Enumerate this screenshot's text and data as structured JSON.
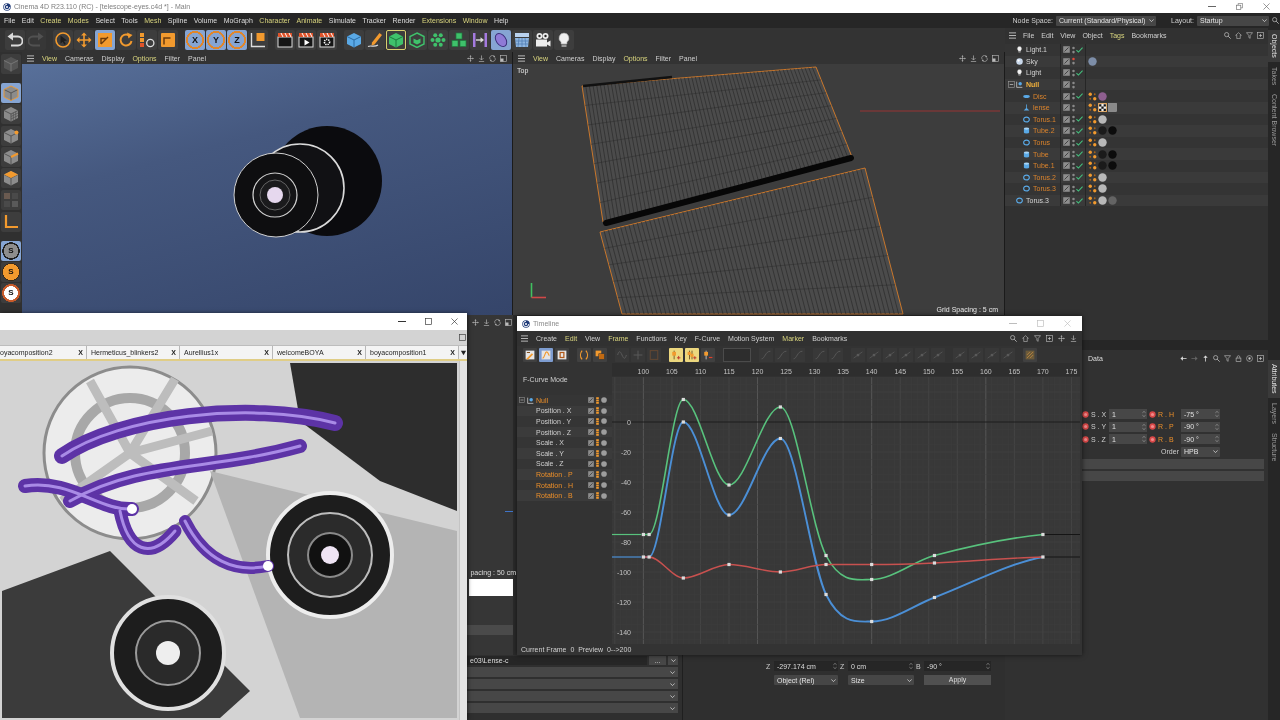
{
  "window": {
    "title": "Cinema 4D R23.110 (RC) - [telescope-eyes.c4d *] - Main"
  },
  "menu": [
    {
      "label": "File",
      "highlighted": false
    },
    {
      "label": "Edit",
      "highlighted": false
    },
    {
      "label": "Create",
      "highlighted": true
    },
    {
      "label": "Modes",
      "highlighted": true
    },
    {
      "label": "Select",
      "highlighted": false
    },
    {
      "label": "Tools",
      "highlighted": false
    },
    {
      "label": "Mesh",
      "highlighted": true
    },
    {
      "label": "Spline",
      "highlighted": false
    },
    {
      "label": "Volume",
      "highlighted": false
    },
    {
      "label": "MoGraph",
      "highlighted": false
    },
    {
      "label": "Character",
      "highlighted": true
    },
    {
      "label": "Animate",
      "highlighted": true
    },
    {
      "label": "Simulate",
      "highlighted": false
    },
    {
      "label": "Tracker",
      "highlighted": false
    },
    {
      "label": "Render",
      "highlighted": false
    },
    {
      "label": "Extensions",
      "highlighted": true
    },
    {
      "label": "Window",
      "highlighted": true
    },
    {
      "label": "Help",
      "highlighted": false
    }
  ],
  "node_space": {
    "label": "Node Space:",
    "value": "Current (Standard/Physical)"
  },
  "layout": {
    "label": "Layout:",
    "value": "Startup"
  },
  "toolbar": [
    {
      "buttons": [
        {
          "kind": "undo",
          "active": false,
          "framed": false,
          "disabled": false
        },
        {
          "kind": "redo",
          "active": false,
          "framed": false,
          "disabled": true
        }
      ]
    },
    {
      "buttons": [
        {
          "kind": "select",
          "active": false,
          "framed": false,
          "disabled": false
        },
        {
          "kind": "move",
          "active": false,
          "framed": false,
          "disabled": false
        },
        {
          "kind": "scale",
          "active": true,
          "framed": false,
          "disabled": false
        },
        {
          "kind": "rotate",
          "active": false,
          "framed": false,
          "disabled": false
        },
        {
          "kind": "psr",
          "active": false,
          "framed": false,
          "disabled": false
        },
        {
          "kind": "recent",
          "active": false,
          "framed": false,
          "disabled": false
        }
      ]
    },
    {
      "buttons": [
        {
          "kind": "axis",
          "label": "X",
          "active": true,
          "framed": false,
          "disabled": false
        },
        {
          "kind": "axis",
          "label": "Y",
          "active": true,
          "framed": false,
          "disabled": false
        },
        {
          "kind": "axis",
          "label": "Z",
          "active": true,
          "framed": false,
          "disabled": false
        },
        {
          "kind": "coord",
          "active": false,
          "framed": false,
          "disabled": false
        }
      ]
    },
    {
      "buttons": [
        {
          "kind": "render-view",
          "active": false,
          "framed": false,
          "disabled": false
        },
        {
          "kind": "render",
          "active": false,
          "framed": false,
          "disabled": false
        },
        {
          "kind": "render-settings",
          "active": false,
          "framed": false,
          "disabled": false
        }
      ]
    },
    {
      "buttons": [
        {
          "kind": "cube",
          "active": false,
          "framed": false,
          "disabled": false
        },
        {
          "kind": "pen",
          "active": false,
          "framed": false,
          "disabled": false
        },
        {
          "kind": "generator",
          "active": false,
          "framed": true,
          "disabled": false
        },
        {
          "kind": "subdivision",
          "active": false,
          "framed": false,
          "disabled": false
        },
        {
          "kind": "cloner",
          "active": false,
          "framed": false,
          "disabled": false
        },
        {
          "kind": "mograph",
          "active": false,
          "framed": false,
          "disabled": false
        },
        {
          "kind": "deformer",
          "active": false,
          "framed": false,
          "disabled": false
        },
        {
          "kind": "field",
          "active": true,
          "framed": false,
          "disabled": false
        },
        {
          "kind": "floor",
          "active": false,
          "framed": false,
          "disabled": false
        },
        {
          "kind": "camera",
          "active": false,
          "framed": false,
          "disabled": false
        },
        {
          "kind": "light",
          "active": false,
          "framed": false,
          "disabled": false
        }
      ]
    }
  ],
  "tool_palette": [
    {
      "buttons": [
        {
          "kind": "editable",
          "active": false
        }
      ]
    },
    {
      "buttons": [
        {
          "kind": "model",
          "active": true
        },
        {
          "kind": "texture",
          "active": false
        }
      ]
    },
    {
      "buttons": [
        {
          "kind": "points",
          "active": false
        },
        {
          "kind": "edges",
          "active": false
        },
        {
          "kind": "polygons",
          "active": false
        }
      ]
    },
    {
      "buttons": [
        {
          "kind": "uv",
          "active": false
        }
      ]
    },
    {
      "buttons": [
        {
          "kind": "axis-mode",
          "active": false
        }
      ]
    },
    {
      "buttons": [
        {
          "kind": "snap-gray",
          "label": "S",
          "active": true
        },
        {
          "kind": "snap-orange",
          "label": "S",
          "active": false
        },
        {
          "kind": "snap-white",
          "label": "S",
          "active": false
        }
      ]
    }
  ],
  "viewports": [
    {
      "kind": "render",
      "menu": [
        {
          "label": "View",
          "highlighted": true
        },
        {
          "label": "Cameras",
          "highlighted": false
        },
        {
          "label": "Display",
          "highlighted": false
        },
        {
          "label": "Options",
          "highlighted": true
        },
        {
          "label": "Filter",
          "highlighted": false
        },
        {
          "label": "Panel",
          "highlighted": false
        }
      ]
    },
    {
      "kind": "wireframe",
      "menu": [
        {
          "label": "View",
          "highlighted": true
        },
        {
          "label": "Cameras",
          "highlighted": false
        },
        {
          "label": "Display",
          "highlighted": false
        },
        {
          "label": "Options",
          "highlighted": true
        },
        {
          "label": "Filter",
          "highlighted": false
        },
        {
          "label": "Panel",
          "highlighted": false
        }
      ],
      "view_label": "Top",
      "grid_spacing": "Grid Spacing : 5 cm"
    }
  ],
  "lower_viewport": {
    "grid_spacing": "pacing : 50 cm"
  },
  "object_manager": {
    "menu": [
      {
        "label": "File",
        "highlighted": false
      },
      {
        "label": "Edit",
        "highlighted": false
      },
      {
        "label": "View",
        "highlighted": false
      },
      {
        "label": "Object",
        "highlighted": false
      },
      {
        "label": "Tags",
        "highlighted": true
      },
      {
        "label": "Bookmarks",
        "highlighted": false
      }
    ],
    "objects": [
      {
        "name": "Light.1",
        "kind": "light",
        "selected": false,
        "enabled": true,
        "editor_visible": true
      },
      {
        "name": "Sky",
        "kind": "sky",
        "selected": false,
        "enabled": false,
        "editor_visible": false,
        "tags": [
          {
            "kind": "material",
            "color": "#7d8ea8"
          }
        ]
      },
      {
        "name": "Light",
        "kind": "light",
        "selected": false,
        "enabled": true,
        "editor_visible": true
      },
      {
        "name": "Null",
        "kind": "null",
        "selected": true,
        "enabled": false,
        "editor_visible": true,
        "expanded": true,
        "children": [
          {
            "name": "Disc",
            "kind": "disc",
            "selected": true,
            "enabled": true,
            "editor_visible": true,
            "tags": [
              {
                "kind": "phong"
              },
              {
                "kind": "material",
                "color": "#8e5f8f"
              }
            ]
          },
          {
            "name": "lense",
            "kind": "instance",
            "selected": true,
            "enabled": false,
            "editor_visible": true,
            "tags": [
              {
                "kind": "phong"
              },
              {
                "kind": "texture"
              },
              {
                "kind": "blank"
              }
            ]
          },
          {
            "name": "Torus.1",
            "kind": "torus",
            "selected": true,
            "enabled": true,
            "editor_visible": true,
            "tags": [
              {
                "kind": "phong"
              },
              {
                "kind": "material",
                "color": "#b8b8b8"
              }
            ]
          },
          {
            "name": "Tube.2",
            "kind": "tube",
            "selected": true,
            "enabled": true,
            "editor_visible": true,
            "tags": [
              {
                "kind": "phong"
              },
              {
                "kind": "material",
                "color": "#1b1b1b"
              },
              {
                "kind": "material",
                "color": "#0c0c0c"
              }
            ]
          },
          {
            "name": "Torus",
            "kind": "torus",
            "selected": true,
            "enabled": true,
            "editor_visible": true,
            "tags": [
              {
                "kind": "phong"
              },
              {
                "kind": "material",
                "color": "#b8b8b8"
              }
            ]
          },
          {
            "name": "Tube",
            "kind": "tube",
            "selected": true,
            "enabled": true,
            "editor_visible": true,
            "tags": [
              {
                "kind": "phong"
              },
              {
                "kind": "material",
                "color": "#1b1b1b"
              },
              {
                "kind": "material",
                "color": "#0c0c0c"
              }
            ]
          },
          {
            "name": "Tube.1",
            "kind": "tube",
            "selected": true,
            "enabled": true,
            "editor_visible": true,
            "tags": [
              {
                "kind": "phong"
              },
              {
                "kind": "material",
                "color": "#1b1b1b"
              },
              {
                "kind": "material",
                "color": "#0c0c0c"
              }
            ]
          },
          {
            "name": "Torus.2",
            "kind": "torus",
            "selected": true,
            "enabled": true,
            "editor_visible": true,
            "tags": [
              {
                "kind": "phong"
              },
              {
                "kind": "material",
                "color": "#b8b8b8"
              }
            ]
          },
          {
            "name": "Torus.3",
            "kind": "torus",
            "selected": true,
            "enabled": true,
            "editor_visible": true,
            "tags": [
              {
                "kind": "phong"
              },
              {
                "kind": "material",
                "color": "#b8b8b8"
              }
            ]
          }
        ]
      },
      {
        "name": "Torus.3",
        "kind": "torus",
        "selected": false,
        "enabled": true,
        "editor_visible": true,
        "tags": [
          {
            "kind": "phong"
          },
          {
            "kind": "material",
            "color": "#b8b8b8"
          },
          {
            "kind": "material",
            "color": "#646464"
          }
        ]
      }
    ]
  },
  "attributes": {
    "title": "Data",
    "fields": [
      {
        "label": "S . X",
        "value": "1",
        "animated": false
      },
      {
        "label": "R . H",
        "value": "-75 °",
        "animated": true
      },
      {
        "label": "S . Y",
        "value": "1",
        "animated": false
      },
      {
        "label": "R . P",
        "value": "-90 °",
        "animated": true
      },
      {
        "label": "S . Z",
        "value": "1",
        "animated": false
      },
      {
        "label": "R . B",
        "value": "-90 °",
        "animated": true
      }
    ],
    "order": {
      "label": "Order",
      "value": "HPB"
    }
  },
  "side_tabs": {
    "top": [
      {
        "label": "Objects",
        "selected": true
      },
      {
        "label": "Takes",
        "selected": false
      },
      {
        "label": "Content Browser",
        "selected": false
      }
    ],
    "bottom": [
      {
        "label": "Attributes",
        "selected": true
      },
      {
        "label": "Layers",
        "selected": false
      },
      {
        "label": "Structure",
        "selected": false
      }
    ]
  },
  "material_panel": {
    "path": "e03\\Lense-c",
    "browse": "..."
  },
  "coordinates": {
    "fields": [
      {
        "label": "Z",
        "value": "-297.174 cm"
      },
      {
        "label": "Z",
        "value": "0 cm"
      },
      {
        "label": "B",
        "value": "-90 °"
      }
    ],
    "mode": "Object (Rel)",
    "size_mode": "Size",
    "apply": "Apply"
  },
  "image_viewer": {
    "tabs": [
      {
        "label": "oyacomposition2",
        "close": "X"
      },
      {
        "label": "Hermeticus_blinkers2",
        "close": "X"
      },
      {
        "label": "Aurellius1x",
        "close": "X"
      },
      {
        "label": "welcomeBOYA",
        "close": "X"
      },
      {
        "label": "boyacomposition1",
        "close": "X"
      }
    ]
  },
  "timeline": {
    "title": "Timeline",
    "menu": [
      {
        "label": "Create",
        "highlighted": false
      },
      {
        "label": "Edit",
        "highlighted": true
      },
      {
        "label": "View",
        "highlighted": false
      },
      {
        "label": "Frame",
        "highlighted": true
      },
      {
        "label": "Functions",
        "highlighted": false
      },
      {
        "label": "Key",
        "highlighted": false
      },
      {
        "label": "F-Curve",
        "highlighted": false
      },
      {
        "label": "Motion System",
        "highlighted": false
      },
      {
        "label": "Marker",
        "highlighted": true
      },
      {
        "label": "Bookmarks",
        "highlighted": false
      }
    ],
    "toolbar": [
      {
        "disabled": false,
        "buttons": [
          {
            "kind": "key-mode",
            "active": false
          },
          {
            "kind": "fcurve-mode",
            "active": true
          },
          {
            "kind": "film",
            "active": false
          }
        ]
      },
      {
        "disabled": false,
        "buttons": [
          {
            "kind": "parens",
            "active": false
          },
          {
            "kind": "keys",
            "active": false
          }
        ]
      },
      {
        "disabled": true,
        "buttons": [
          {
            "kind": "wave",
            "active": false
          },
          {
            "kind": "cross",
            "active": false
          },
          {
            "kind": "frame",
            "active": false
          }
        ]
      },
      {
        "disabled": false,
        "buttons": [
          {
            "kind": "key-add",
            "active": true
          },
          {
            "kind": "key-add-multi",
            "active": true
          },
          {
            "kind": "key-remove",
            "active": false
          }
        ]
      },
      {
        "disabled": true,
        "buttons": [
          {
            "kind": "value-field",
            "active": false
          }
        ]
      },
      {
        "disabled": true,
        "buttons": [
          {
            "kind": "curve",
            "active": false
          },
          {
            "kind": "curve",
            "active": false
          },
          {
            "kind": "curve",
            "active": false
          }
        ]
      },
      {
        "disabled": true,
        "buttons": [
          {
            "kind": "curve",
            "active": false
          },
          {
            "kind": "curve",
            "active": false
          }
        ]
      },
      {
        "disabled": true,
        "buttons": [
          {
            "kind": "tangent",
            "active": false
          },
          {
            "kind": "tangent",
            "active": false
          },
          {
            "kind": "tangent",
            "active": false
          },
          {
            "kind": "tangent",
            "active": false
          },
          {
            "kind": "tangent",
            "active": false
          },
          {
            "kind": "tangent",
            "active": false
          }
        ]
      },
      {
        "disabled": true,
        "buttons": [
          {
            "kind": "tangent",
            "active": false
          },
          {
            "kind": "tangent",
            "active": false
          },
          {
            "kind": "tangent",
            "active": false
          },
          {
            "kind": "tangent",
            "active": false
          }
        ]
      },
      {
        "disabled": false,
        "buttons": [
          {
            "kind": "snap",
            "active": false
          }
        ]
      }
    ],
    "mode_label": "F-Curve Mode",
    "tracks": [
      {
        "name": "Null",
        "kind": "null",
        "selected": true,
        "expanded": true,
        "children": [
          {
            "name": "Position . X",
            "selected": false
          },
          {
            "name": "Position . Y",
            "selected": false
          },
          {
            "name": "Position . Z",
            "selected": false
          },
          {
            "name": "Scale . X",
            "selected": false
          },
          {
            "name": "Scale . Y",
            "selected": false
          },
          {
            "name": "Scale . Z",
            "selected": false
          },
          {
            "name": "Rotation . P",
            "selected": true
          },
          {
            "name": "Rotation . H",
            "selected": true
          },
          {
            "name": "Rotation . B",
            "selected": true
          }
        ]
      }
    ],
    "chart_data": {
      "type": "line",
      "grid": true,
      "x": [
        100,
        101,
        107,
        115,
        124,
        132,
        140,
        151,
        170
      ],
      "series": [
        {
          "color": "#58c27d",
          "marker": "square",
          "values": [
            -75,
            -75,
            15,
            -42,
            10,
            -89,
            -105,
            -89,
            -75
          ]
        },
        {
          "color": "#4b8fd6",
          "marker": "square",
          "values": [
            -90,
            -90,
            0,
            -62,
            -11,
            -115,
            -133,
            -117,
            -90
          ]
        },
        {
          "color": "#c8514f",
          "marker": "square",
          "values": [
            -90,
            -90,
            -104,
            -95,
            -100,
            -95,
            -95,
            -94,
            -90
          ]
        }
      ],
      "xlim": [
        94.5,
        176.5
      ],
      "ylim": [
        -148,
        30
      ],
      "xticks": [
        100,
        105,
        110,
        115,
        120,
        125,
        130,
        135,
        140,
        145,
        150,
        155,
        160,
        165,
        170,
        175
      ],
      "yticks": [
        0,
        -20,
        -40,
        -60,
        -80,
        -100,
        -120,
        -140
      ]
    },
    "status": "Current Frame  0  Preview  0-->200"
  }
}
